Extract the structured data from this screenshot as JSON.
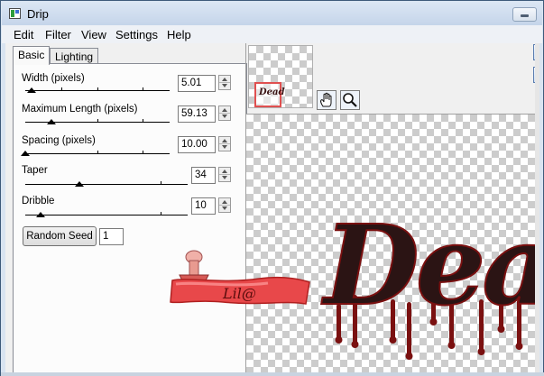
{
  "window": {
    "title": "Drip",
    "minimize_icon": "minimize-icon"
  },
  "menu": {
    "items": [
      "Edit",
      "Filter",
      "View",
      "Settings",
      "Help"
    ]
  },
  "tabs": [
    {
      "label": "Basic",
      "active": true
    },
    {
      "label": "Lighting",
      "active": false
    }
  ],
  "params": {
    "width": {
      "label": "Width (pixels)",
      "value": "5.01",
      "fraction": 0.07
    },
    "max_length": {
      "label": "Maximum Length (pixels)",
      "value": "59.13",
      "fraction": 0.18
    },
    "spacing": {
      "label": "Spacing (pixels)",
      "value": "10.00",
      "fraction": 0.03
    },
    "taper": {
      "label": "Taper",
      "value": "34",
      "fraction": 0.34
    },
    "dribble": {
      "label": "Dribble",
      "value": "10",
      "fraction": 0.1
    }
  },
  "random_seed": {
    "button_label": "Random Seed",
    "value": "1"
  },
  "tools": {
    "pan": "hand-icon",
    "zoom": "magnifier-icon"
  },
  "preview": {
    "nav_thumbnail_text": "Dead",
    "text": "Dead",
    "text_color": "#2b1414",
    "drip_color": "#7a1010"
  },
  "watermark": {
    "text": "Lil@",
    "color": "#e8484a"
  }
}
